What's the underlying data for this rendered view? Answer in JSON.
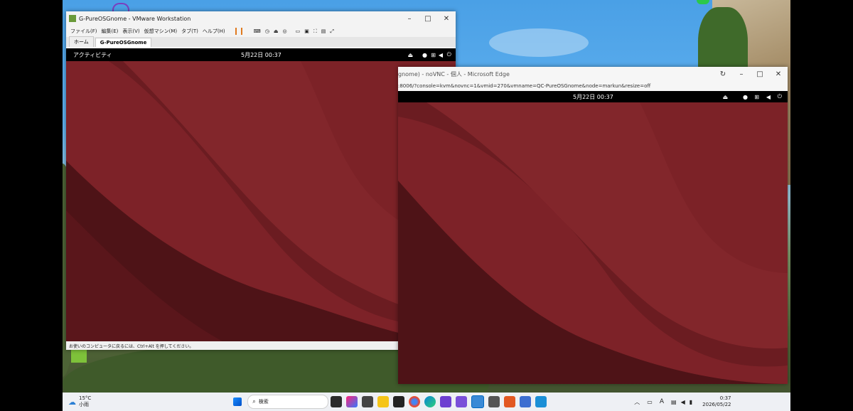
{
  "vmware": {
    "title": "G-PureOSGnome - VMware Workstation",
    "menu": [
      "ファイル(F)",
      "編集(E)",
      "表示(V)",
      "仮想マシン(M)",
      "タブ(T)",
      "ヘルプ(H)"
    ],
    "tabs": [
      "ホーム",
      "G-PureOSGnome"
    ],
    "status_text": "お使いのコンピュータに戻るには、Ctrl+Alt を押してください。"
  },
  "gnome_left": {
    "activities": "アクティビティ",
    "clock": "5月22日  00:37"
  },
  "edge": {
    "title": "gnome) - noVNC - 個人 - Microsoft Edge",
    "url": ":8006/?console=kvm&novnc=1&vmid=270&vmname=QC-PureOSGnome&node=markun&resize=off",
    "clock": "5月22日  00:37"
  },
  "taskbar": {
    "weather_temp": "15°C",
    "weather_desc": "小雨",
    "search_placeholder": "検索",
    "time": "0:37",
    "date": "2026/05/22",
    "ime": "A"
  },
  "colors": {
    "wallpaper": "#6e1d22",
    "taskbar": "#eef0f4",
    "accent": "#0067c0"
  }
}
